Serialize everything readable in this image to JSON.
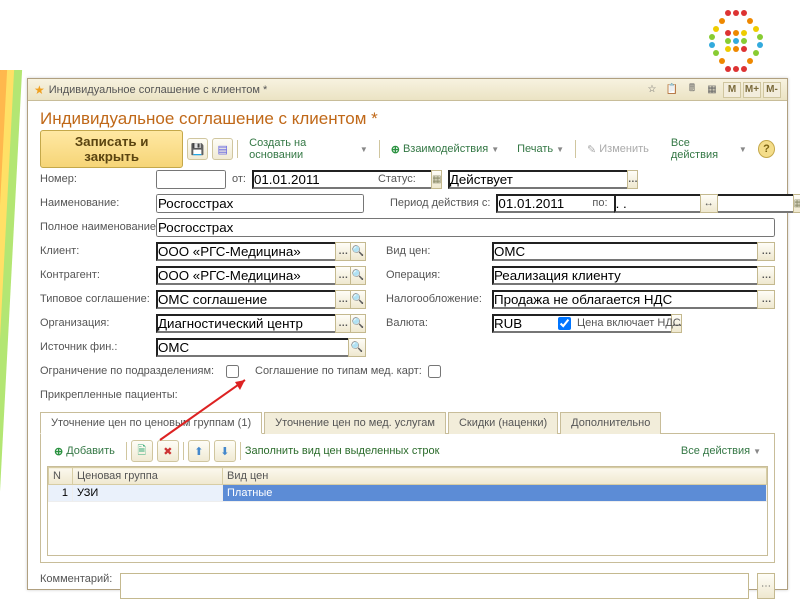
{
  "window": {
    "title": "Индивидуальное соглашение с клиентом *"
  },
  "header": {
    "title": "Индивидуальное соглашение с клиентом *",
    "save_close": "Записать и закрыть",
    "create_from": "Создать на основании",
    "interactions": "Взаимодействия",
    "print": "Печать",
    "edit": "Изменить",
    "all_actions": "Все действия"
  },
  "fields": {
    "number_lbl": "Номер:",
    "number": "",
    "from_lbl": "от:",
    "from_date": "01.01.2011",
    "status_lbl": "Статус:",
    "status": "Действует",
    "name_lbl": "Наименование:",
    "name": "Росгосстрах",
    "period_lbl": "Период действия с:",
    "period_from": "01.01.2011",
    "to_lbl": "по:",
    "period_to": ". .",
    "fullname_lbl": "Полное наименование:",
    "fullname": "Росгосстрах",
    "client_lbl": "Клиент:",
    "client": "ООО «РГС-Медицина»",
    "pricetype_lbl": "Вид цен:",
    "pricetype": "ОМС",
    "contragent_lbl": "Контрагент:",
    "contragent": "ООО «РГС-Медицина»",
    "operation_lbl": "Операция:",
    "operation": "Реализация клиенту",
    "template_lbl": "Типовое соглашение:",
    "template": "ОМС соглашение",
    "tax_lbl": "Налогообложение:",
    "tax": "Продажа не облагается НДС",
    "org_lbl": "Организация:",
    "org": "Диагностический центр",
    "currency_lbl": "Валюта:",
    "currency": "RUB",
    "vat_incl_lbl": "Цена включает НДС",
    "finsrc_lbl": "Источник фин.:",
    "finsrc": "ОМС",
    "restrict_dept_lbl": "Ограничение по подразделениям:",
    "cardtypes_lbl": "Соглашение по типам мед. карт:",
    "patients_lbl": "Прикрепленные пациенты:"
  },
  "tabs": {
    "t1": "Уточнение цен по ценовым группам (1)",
    "t2": "Уточнение цен по мед. услугам",
    "t3": "Скидки (наценки)",
    "t4": "Дополнительно"
  },
  "grid_tb": {
    "add": "Добавить",
    "fill_hint": "Заполнить вид цен выделенных строк",
    "all_actions": "Все действия"
  },
  "grid": {
    "col_n": "N",
    "col_group": "Ценовая группа",
    "col_price": "Вид цен",
    "rows": [
      {
        "n": "1",
        "group": "УЗИ",
        "price": "Платные"
      }
    ]
  },
  "comment_lbl": "Комментарий:",
  "comment": ""
}
